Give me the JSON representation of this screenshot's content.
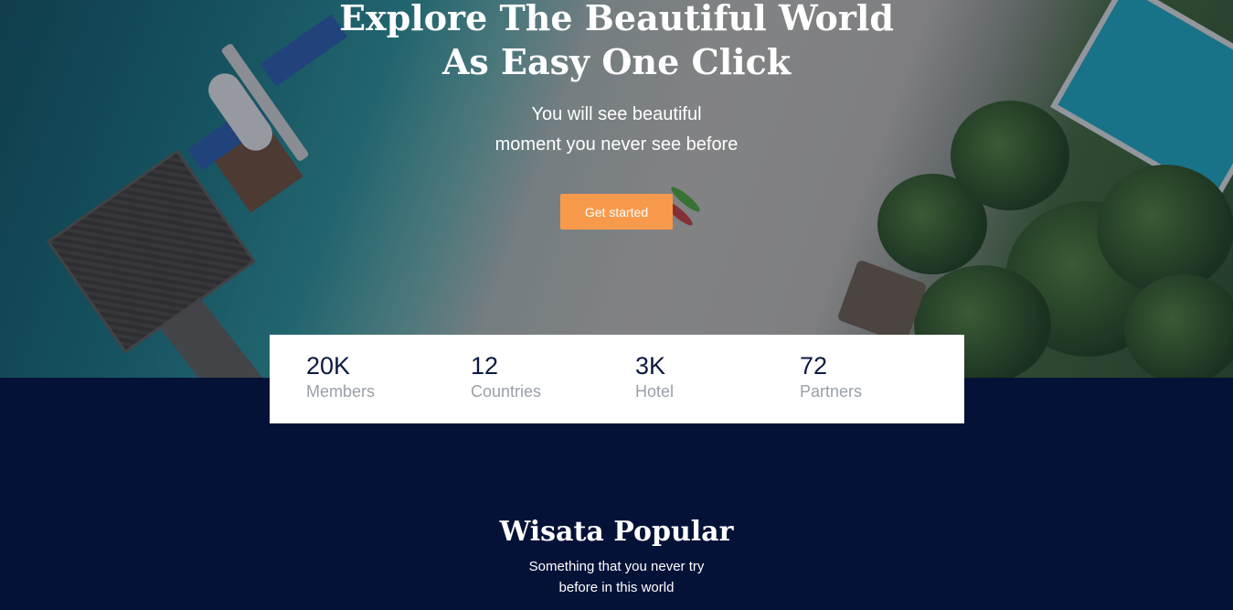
{
  "hero": {
    "title_line1": "Explore The Beautiful World",
    "title_line2": "As Easy One Click",
    "subtitle_line1": "You will see beautiful",
    "subtitle_line2": "moment you never see before",
    "cta_label": "Get started"
  },
  "stats": [
    {
      "value": "20K",
      "label": "Members"
    },
    {
      "value": "12",
      "label": "Countries"
    },
    {
      "value": "3K",
      "label": "Hotel"
    },
    {
      "value": "72",
      "label": "Partners"
    }
  ],
  "popular": {
    "title": "Wisata Popular",
    "subtitle_line1": "Something that you never try",
    "subtitle_line2": "before in this world"
  },
  "colors": {
    "accent": "#f89a4c",
    "background": "#051238",
    "stat_value": "#0b1a3f",
    "stat_label": "#9aa0a8"
  }
}
